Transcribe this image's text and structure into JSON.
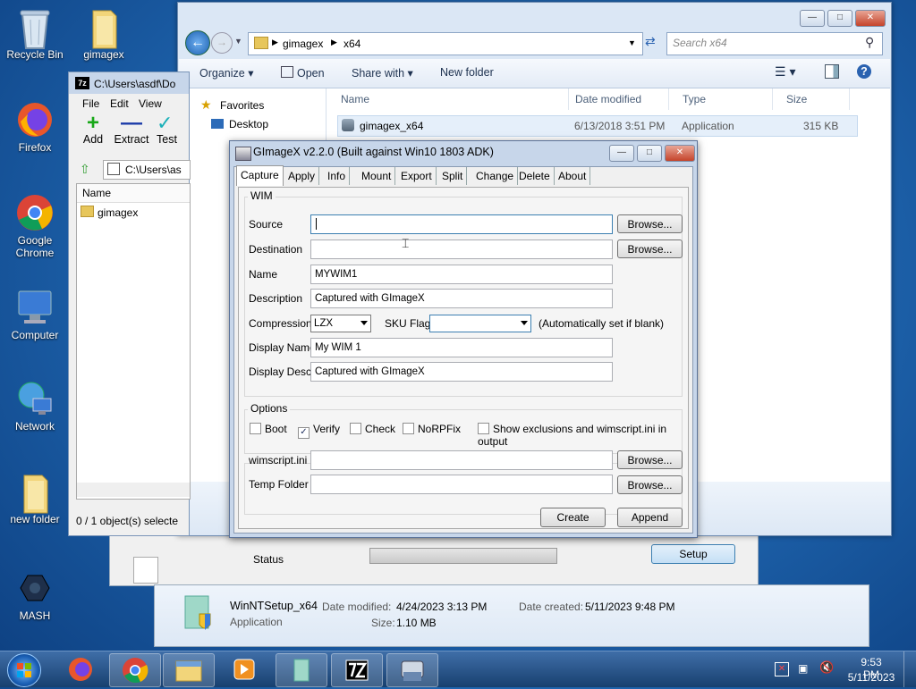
{
  "desktop": {
    "icons": [
      {
        "label": "Recycle Bin"
      },
      {
        "label": "gimagex"
      },
      {
        "label": "Firefox"
      },
      {
        "label": "Google Chrome"
      },
      {
        "label": "Computer"
      },
      {
        "label": "Network"
      },
      {
        "label": "new folder"
      },
      {
        "label": "MASH"
      }
    ]
  },
  "explorer": {
    "address": [
      "gimagex",
      "x64"
    ],
    "search_placeholder": "Search x64",
    "commands": {
      "organize": "Organize",
      "open": "Open",
      "share_with": "Share with",
      "new_folder": "New folder"
    },
    "nav": {
      "favorites": "Favorites",
      "desktop": "Desktop"
    },
    "columns": {
      "name": "Name",
      "date": "Date modified",
      "type": "Type",
      "size": "Size"
    },
    "files": [
      {
        "name": "gimagex_x64",
        "date": "6/13/2018 3:51 PM",
        "type": "Application",
        "size": "315 KB"
      }
    ]
  },
  "sevenzip": {
    "title": "C:\\Users\\asdf\\Do",
    "menu": {
      "file": "File",
      "edit": "Edit",
      "view": "View"
    },
    "toolbar": {
      "add": "Add",
      "extract": "Extract",
      "test": "Test"
    },
    "path": "C:\\Users\\as",
    "column_name": "Name",
    "items": [
      "gimagex"
    ],
    "status": "0 / 1 object(s) selecte"
  },
  "winntsetup": {
    "status_label": "Status",
    "setup_button": "Setup",
    "details": {
      "name": "WinNTSetup_x64",
      "type": "Application",
      "date_modified_label": "Date modified:",
      "date_modified": "4/24/2023 3:13 PM",
      "date_created_label": "Date created:",
      "date_created": "5/11/2023 9:48 PM",
      "size_label": "Size:",
      "size": "1.10 MB"
    }
  },
  "gimagex": {
    "title": "GImageX v2.2.0 (Built against Win10 1803 ADK)",
    "tabs": [
      "Capture",
      "Apply",
      "Info",
      "Mount",
      "Export",
      "Split",
      "Change",
      "Delete",
      "About"
    ],
    "wim_group": "WIM",
    "source_label": "Source",
    "source_value": "",
    "destination_label": "Destination",
    "destination_value": "",
    "name_label": "Name",
    "name_value": "MYWIM1",
    "description_label": "Description",
    "description_value": "Captured with GImageX",
    "compression_label": "Compression",
    "compression_value": "LZX",
    "sku_label": "SKU Flag",
    "sku_value": "",
    "sku_hint": "(Automatically set if blank)",
    "display_name_label": "Display Name",
    "display_name_value": "My WIM 1",
    "display_desc_label": "Display Desc.",
    "display_desc_value": "Captured with GImageX",
    "browse": "Browse...",
    "options_group": "Options",
    "options": {
      "boot": {
        "label": "Boot",
        "checked": false
      },
      "verify": {
        "label": "Verify",
        "checked": true
      },
      "check": {
        "label": "Check",
        "checked": false
      },
      "norpfix": {
        "label": "NoRPFix",
        "checked": false
      },
      "show_exclusions": {
        "label": "Show exclusions and wimscript.ini in output",
        "checked": false
      }
    },
    "wimscript_label": "wimscript.ini",
    "temp_folder_label": "Temp Folder",
    "create_button": "Create",
    "append_button": "Append"
  },
  "taskbar": {
    "time": "9:53 PM",
    "date": "5/11/2023"
  },
  "colors": {
    "accent": "#3a8fd6",
    "taskbar": "#18406f",
    "window_frame": "#c7d6ea"
  }
}
